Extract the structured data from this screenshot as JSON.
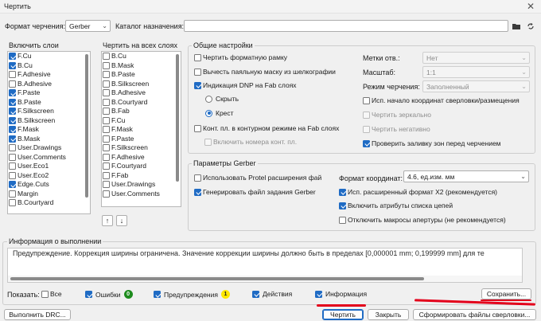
{
  "window": {
    "title": "Чертить"
  },
  "format_row": {
    "format_label": "Формат черчения:",
    "format_value": "Gerber",
    "catalog_label": "Каталог назначения:",
    "catalog_value": ""
  },
  "layers": {
    "title": "Включить слои",
    "items": [
      {
        "label": "F.Cu",
        "checked": true
      },
      {
        "label": "B.Cu",
        "checked": true
      },
      {
        "label": "F.Adhesive",
        "checked": false
      },
      {
        "label": "B.Adhesive",
        "checked": false
      },
      {
        "label": "F.Paste",
        "checked": true
      },
      {
        "label": "B.Paste",
        "checked": true
      },
      {
        "label": "F.Silkscreen",
        "checked": true
      },
      {
        "label": "B.Silkscreen",
        "checked": true
      },
      {
        "label": "F.Mask",
        "checked": true
      },
      {
        "label": "B.Mask",
        "checked": true
      },
      {
        "label": "User.Drawings",
        "checked": false
      },
      {
        "label": "User.Comments",
        "checked": false
      },
      {
        "label": "User.Eco1",
        "checked": false
      },
      {
        "label": "User.Eco2",
        "checked": false
      },
      {
        "label": "Edge.Cuts",
        "checked": true
      },
      {
        "label": "Margin",
        "checked": false
      },
      {
        "label": "B.Courtyard",
        "checked": false
      }
    ]
  },
  "all_layers": {
    "title": "Чертить на всех слоях",
    "items": [
      {
        "label": "B.Cu",
        "checked": false
      },
      {
        "label": "B.Mask",
        "checked": false
      },
      {
        "label": "B.Paste",
        "checked": false
      },
      {
        "label": "B.Silkscreen",
        "checked": false
      },
      {
        "label": "B.Adhesive",
        "checked": false
      },
      {
        "label": "B.Courtyard",
        "checked": false
      },
      {
        "label": "B.Fab",
        "checked": false
      },
      {
        "label": "F.Cu",
        "checked": false
      },
      {
        "label": "F.Mask",
        "checked": false
      },
      {
        "label": "F.Paste",
        "checked": false
      },
      {
        "label": "F.Silkscreen",
        "checked": false
      },
      {
        "label": "F.Adhesive",
        "checked": false
      },
      {
        "label": "F.Courtyard",
        "checked": false
      },
      {
        "label": "F.Fab",
        "checked": false
      },
      {
        "label": "User.Drawings",
        "checked": false
      },
      {
        "label": "User.Comments",
        "checked": false
      }
    ]
  },
  "general": {
    "title": "Общие настройки",
    "left": {
      "draw_frame": {
        "label": "Чертить форматную рамку",
        "checked": false
      },
      "subtract_mask": {
        "label": "Вычесть паяльную маску из шелкографии",
        "checked": false
      },
      "dnp_fab": {
        "label": "Индикация DNP на Fab слоях",
        "checked": true
      },
      "hide": {
        "label": "Скрыть",
        "selected": false
      },
      "cross": {
        "label": "Крест",
        "selected": true
      },
      "outline_mode": {
        "label": "Конт. пл. в контурном режиме на Fab слоях",
        "checked": false
      },
      "pad_numbers": {
        "label": "Включить номера конт. пл.",
        "checked": false
      }
    },
    "right": {
      "drill_marks_label": "Метки отв.:",
      "drill_marks_value": "Нет",
      "scale_label": "Масштаб:",
      "scale_value": "1:1",
      "mode_label": "Режим черчения:",
      "mode_value": "Заполненный",
      "drill_origin": {
        "label": "Исп. начало координат сверловки/размещения",
        "checked": false
      },
      "mirror": {
        "label": "Чертить зеркально",
        "checked": false
      },
      "negative": {
        "label": "Чертить негативно",
        "checked": false
      },
      "check_zones": {
        "label": "Проверить заливку зон перед черчением",
        "checked": true
      }
    }
  },
  "gerber": {
    "title": "Параметры Gerber",
    "protel": {
      "label": "Использовать Protel расширения фай",
      "checked": false
    },
    "job_file": {
      "label": "Генерировать файл задания Gerber",
      "checked": true
    },
    "coord_label": "Формат координат:",
    "coord_value": "4.6, ед.изм. мм",
    "x2": {
      "label": "Исп. расширенный формат X2 (рекомендуется)",
      "checked": true
    },
    "netlist": {
      "label": "Включить атрибуты списка цепей",
      "checked": true
    },
    "disable_aperture": {
      "label": "Отключить макросы апертуры (не рекомендуется)",
      "checked": false
    }
  },
  "info": {
    "title": "Информация о выполнении",
    "message": "Предупреждение. Коррекция ширины ограничена.  Значение коррекции ширины должно быть в пределах [0,000001 mm; 0,199999 mm] для те"
  },
  "filters": {
    "show_label": "Показать:",
    "all": {
      "label": "Все",
      "checked": false
    },
    "errors": {
      "label": "Ошибки",
      "checked": true,
      "count": "0"
    },
    "warnings": {
      "label": "Предупреждения",
      "checked": true,
      "count": "1"
    },
    "actions": {
      "label": "Действия",
      "checked": true
    },
    "info": {
      "label": "Информация",
      "checked": true
    }
  },
  "buttons": {
    "save": "Сохранить...",
    "run_drc": "Выполнить DRC...",
    "plot": "Чертить",
    "close": "Закрыть",
    "drill_files": "Сформировать файлы сверловки..."
  },
  "colors": {
    "accent": "#1f6bc4",
    "errors_badge": "#1e8c1e",
    "warnings_badge": "#ffe800",
    "annotation": "#e3001b"
  }
}
